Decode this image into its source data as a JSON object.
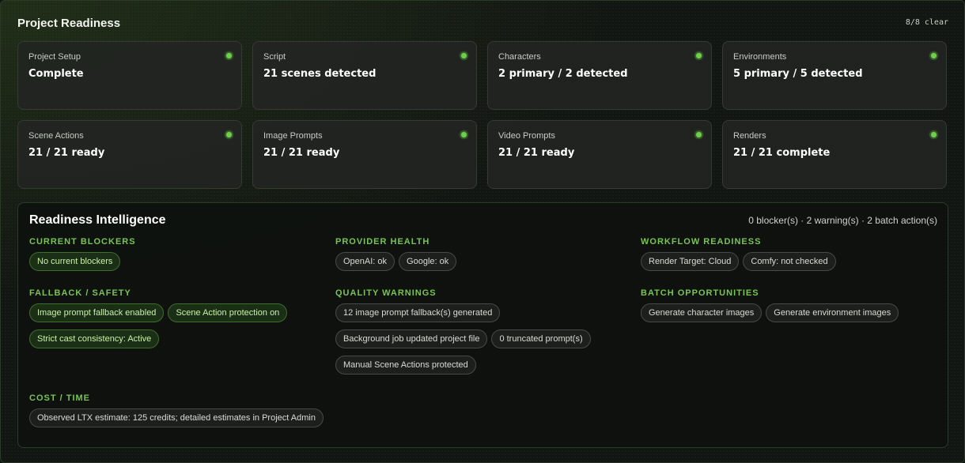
{
  "header": {
    "title": "Project Readiness",
    "status": "8/8 clear"
  },
  "cards": [
    {
      "label": "Project Setup",
      "value": "Complete"
    },
    {
      "label": "Script",
      "value": "21 scenes detected"
    },
    {
      "label": "Characters",
      "value": "2 primary / 2 detected"
    },
    {
      "label": "Environments",
      "value": "5 primary / 5 detected"
    },
    {
      "label": "Scene Actions",
      "value": "21 / 21 ready"
    },
    {
      "label": "Image Prompts",
      "value": "21 / 21 ready"
    },
    {
      "label": "Video Prompts",
      "value": "21 / 21 ready"
    },
    {
      "label": "Renders",
      "value": "21 / 21 complete"
    }
  ],
  "status_color": "#6ed04a",
  "intelligence": {
    "title": "Readiness Intelligence",
    "summary": "0 blocker(s) · 2 warning(s) · 2 batch action(s)",
    "sections": {
      "blockers": {
        "title": "CURRENT BLOCKERS",
        "chips": [
          "No current blockers"
        ]
      },
      "provider": {
        "title": "PROVIDER HEALTH",
        "chips": [
          "OpenAI: ok",
          "Google: ok"
        ]
      },
      "workflow": {
        "title": "WORKFLOW READINESS",
        "chips": [
          "Render Target: Cloud",
          "Comfy: not checked"
        ]
      },
      "fallback": {
        "title": "FALLBACK / SAFETY",
        "chips": [
          "Image prompt fallback enabled",
          "Scene Action protection on",
          "Strict cast consistency: Active"
        ]
      },
      "quality": {
        "title": "QUALITY WARNINGS",
        "chips": [
          "12 image prompt fallback(s) generated",
          "Background job updated project file",
          "0 truncated prompt(s)",
          "Manual Scene Actions protected"
        ]
      },
      "batch": {
        "title": "BATCH OPPORTUNITIES",
        "chips": [
          "Generate character images",
          "Generate environment images"
        ]
      },
      "cost": {
        "title": "COST / TIME",
        "chips": [
          "Observed LTX estimate: 125 credits; detailed estimates in Project Admin"
        ]
      }
    }
  }
}
